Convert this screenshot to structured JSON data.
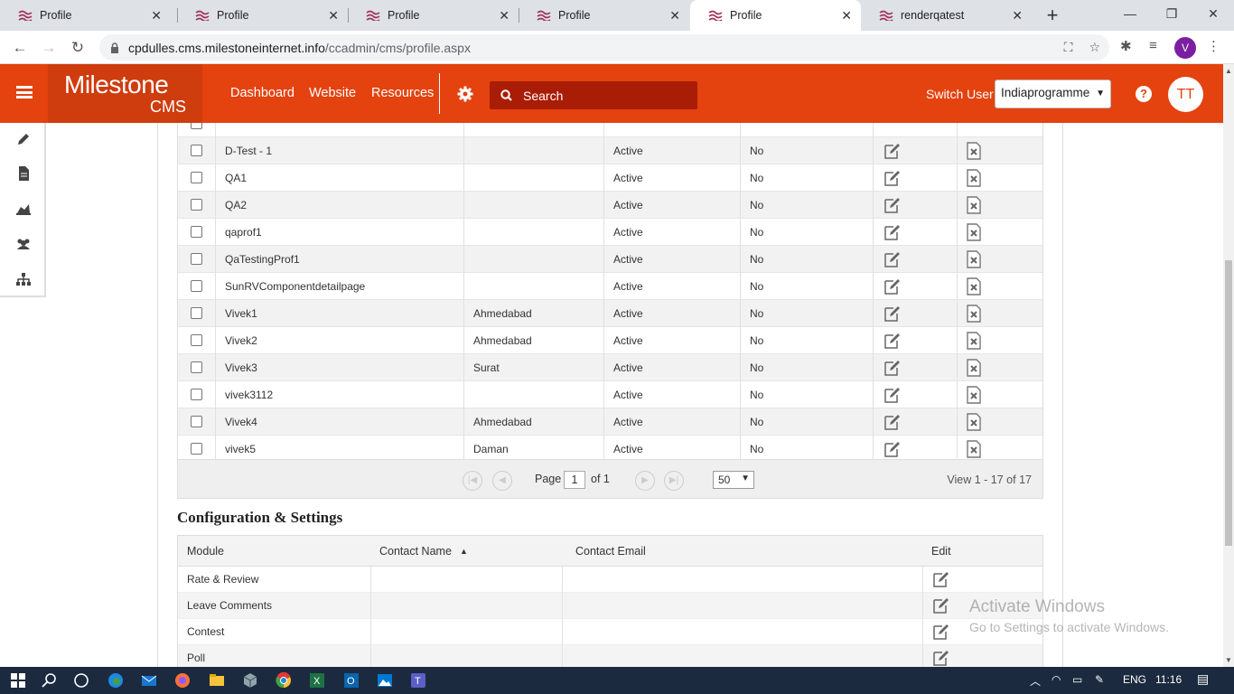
{
  "browser": {
    "tabs": [
      {
        "label": "Profile",
        "active": false
      },
      {
        "label": "Profile",
        "active": false
      },
      {
        "label": "Profile",
        "active": false
      },
      {
        "label": "Profile",
        "active": false
      },
      {
        "label": "Profile",
        "active": true
      },
      {
        "label": "renderqatest",
        "active": false
      }
    ],
    "url_host": "cpdulles.cms.milestoneinternet.info",
    "url_path": "/ccadmin/cms/profile.aspx",
    "profile_initial": "V"
  },
  "header": {
    "logo_main": "Milestone",
    "logo_sub": "CMS",
    "nav": [
      "Dashboard",
      "Website",
      "Resources"
    ],
    "search_placeholder": "Search",
    "switch_user_label": "Switch User",
    "switch_user_value": "Indiaprogramme",
    "help_label": "?",
    "user_initials": "TT",
    "brand_color": "#e4420f"
  },
  "sidebar_icons": [
    "pencil-icon",
    "document-icon",
    "chart-icon",
    "users-icon",
    "sitemap-icon"
  ],
  "profiles": {
    "rows": [
      {
        "name": "D-Test - 1",
        "city": "",
        "status": "Active",
        "flag": "No"
      },
      {
        "name": "QA1",
        "city": "",
        "status": "Active",
        "flag": "No"
      },
      {
        "name": "QA2",
        "city": "",
        "status": "Active",
        "flag": "No"
      },
      {
        "name": "qaprof1",
        "city": "",
        "status": "Active",
        "flag": "No"
      },
      {
        "name": "QaTestingProf1",
        "city": "",
        "status": "Active",
        "flag": "No"
      },
      {
        "name": "SunRVComponentdetailpage",
        "city": "",
        "status": "Active",
        "flag": "No"
      },
      {
        "name": "Vivek1",
        "city": "Ahmedabad",
        "status": "Active",
        "flag": "No"
      },
      {
        "name": "Vivek2",
        "city": "Ahmedabad",
        "status": "Active",
        "flag": "No"
      },
      {
        "name": "Vivek3",
        "city": "Surat",
        "status": "Active",
        "flag": "No"
      },
      {
        "name": "vivek3112",
        "city": "",
        "status": "Active",
        "flag": "No"
      },
      {
        "name": "Vivek4",
        "city": "Ahmedabad",
        "status": "Active",
        "flag": "No"
      },
      {
        "name": "vivek5",
        "city": "Daman",
        "status": "Active",
        "flag": "No"
      }
    ],
    "pager": {
      "page_label": "Page",
      "page_value": "1",
      "of_label": "of 1",
      "page_size": "50",
      "view_text": "View 1 - 17 of 17"
    }
  },
  "config": {
    "title": "Configuration & Settings",
    "columns": [
      "Module",
      "Contact Name",
      "Contact Email",
      "Edit"
    ],
    "sort_indicator": "▲",
    "rows": [
      {
        "module": "Rate & Review",
        "contact_name": "",
        "contact_email": ""
      },
      {
        "module": "Leave Comments",
        "contact_name": "",
        "contact_email": ""
      },
      {
        "module": "Contest",
        "contact_name": "",
        "contact_email": ""
      },
      {
        "module": "Poll",
        "contact_name": "",
        "contact_email": ""
      }
    ]
  },
  "watermark": {
    "line1": "Activate Windows",
    "line2": "Go to Settings to activate Windows."
  },
  "taskbar": {
    "language": "ENG",
    "time": "11:16"
  }
}
